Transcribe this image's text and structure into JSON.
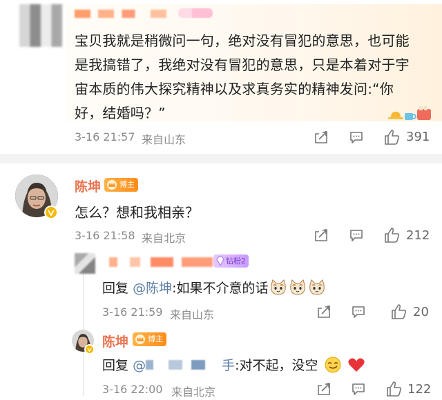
{
  "comment1": {
    "text": "宝贝我就是稍微问一句，绝对没有冒犯的意思，也可能是我搞错了，我绝对没有冒犯的意思，只是本着对于宇宙本质的伟大探究精神以及求真务实的精神发问:“你好，结婚吗？”",
    "time": "3-16 21:57",
    "source": "来自山东",
    "likes": "391"
  },
  "comment2": {
    "name": "陈坤",
    "badge": "博主",
    "text": "怎么？想和我相亲？",
    "time": "3-16 21:58",
    "source": "来自北京",
    "likes": "212"
  },
  "reply1": {
    "badge": "钻粉2",
    "reply_word": "回复",
    "mention": "@陈坤",
    "text": ":如果不介意的话",
    "time": "3-16 21:59",
    "source": "来自山东",
    "likes": "20"
  },
  "reply2": {
    "name": "陈坤",
    "badge": "博主",
    "reply_word": "回复",
    "mention_start": "@",
    "mention_end": "手",
    "text": ":对不起，没空",
    "time": "3-16 22:00",
    "source": "来自北京",
    "likes": "122"
  },
  "colors": {
    "name": "#eb7350",
    "mention": "#5b7ea7",
    "meta": "#8a8a8a",
    "badge_bozhu": "#ff9a2e",
    "badge_zuanfen": "#c79bff"
  },
  "icons": [
    "share-icon",
    "comment-icon",
    "like-icon",
    "v-badge-icon",
    "cat-emoji",
    "smirk-emoji",
    "heart-emoji"
  ]
}
